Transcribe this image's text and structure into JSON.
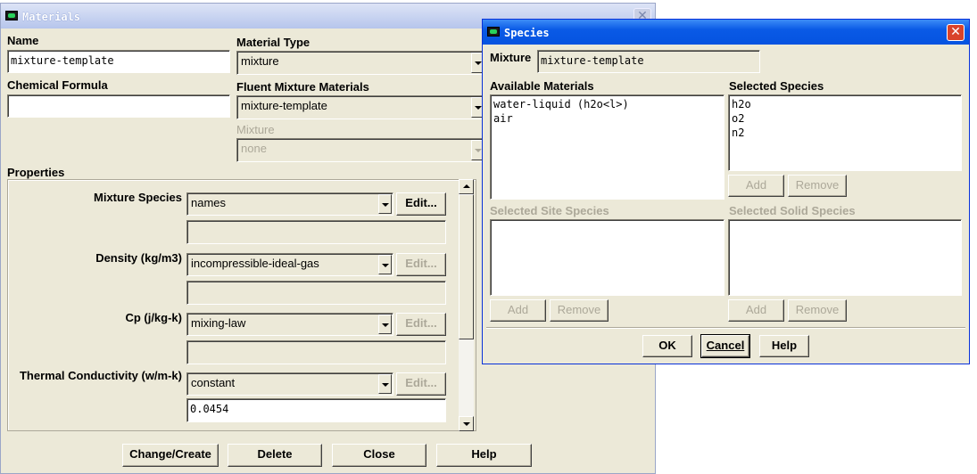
{
  "materials": {
    "title": "Materials",
    "name_label": "Name",
    "name_value": "mixture-template",
    "formula_label": "Chemical Formula",
    "formula_value": "",
    "material_type_label": "Material Type",
    "material_type_value": "mixture",
    "fluent_mixture_label": "Fluent Mixture Materials",
    "fluent_mixture_value": "mixture-template",
    "mixture_label": "Mixture",
    "mixture_value": "none",
    "properties_label": "Properties",
    "properties": [
      {
        "label": "Mixture Species",
        "method": "names",
        "edit_label": "Edit...",
        "value": ""
      },
      {
        "label": "Density (kg/m3)",
        "method": "incompressible-ideal-gas",
        "edit_label": "Edit...",
        "value": ""
      },
      {
        "label": "Cp (j/kg-k)",
        "method": "mixing-law",
        "edit_label": "Edit...",
        "value": ""
      },
      {
        "label": "Thermal Conductivity (w/m-k)",
        "method": "constant",
        "edit_label": "Edit...",
        "value": "0.0454"
      }
    ],
    "buttons": {
      "change_create": "Change/Create",
      "delete": "Delete",
      "close": "Close",
      "help": "Help"
    }
  },
  "species": {
    "title": "Species",
    "mixture_label": "Mixture",
    "mixture_value": "mixture-template",
    "available_label": "Available Materials",
    "available": [
      "water-liquid (h2o<l>)",
      "air"
    ],
    "selected_label": "Selected Species",
    "selected": [
      "h2o",
      "o2",
      "n2"
    ],
    "site_label": "Selected Site Species",
    "solid_label": "Selected Solid Species",
    "add_label": "Add",
    "remove_label": "Remove",
    "ok_label": "OK",
    "cancel_label": "Cancel",
    "help_label": "Help"
  },
  "colors": {
    "dialog_bg": "#ece9d8",
    "titlebar": "#b6c5ec",
    "close_red": "#d9432a",
    "disabled_text": "#aca899"
  },
  "icons": [
    "fluent-app-icon",
    "close-icon",
    "dropdown-arrow-icon",
    "scroll-up-icon",
    "scroll-down-icon"
  ]
}
